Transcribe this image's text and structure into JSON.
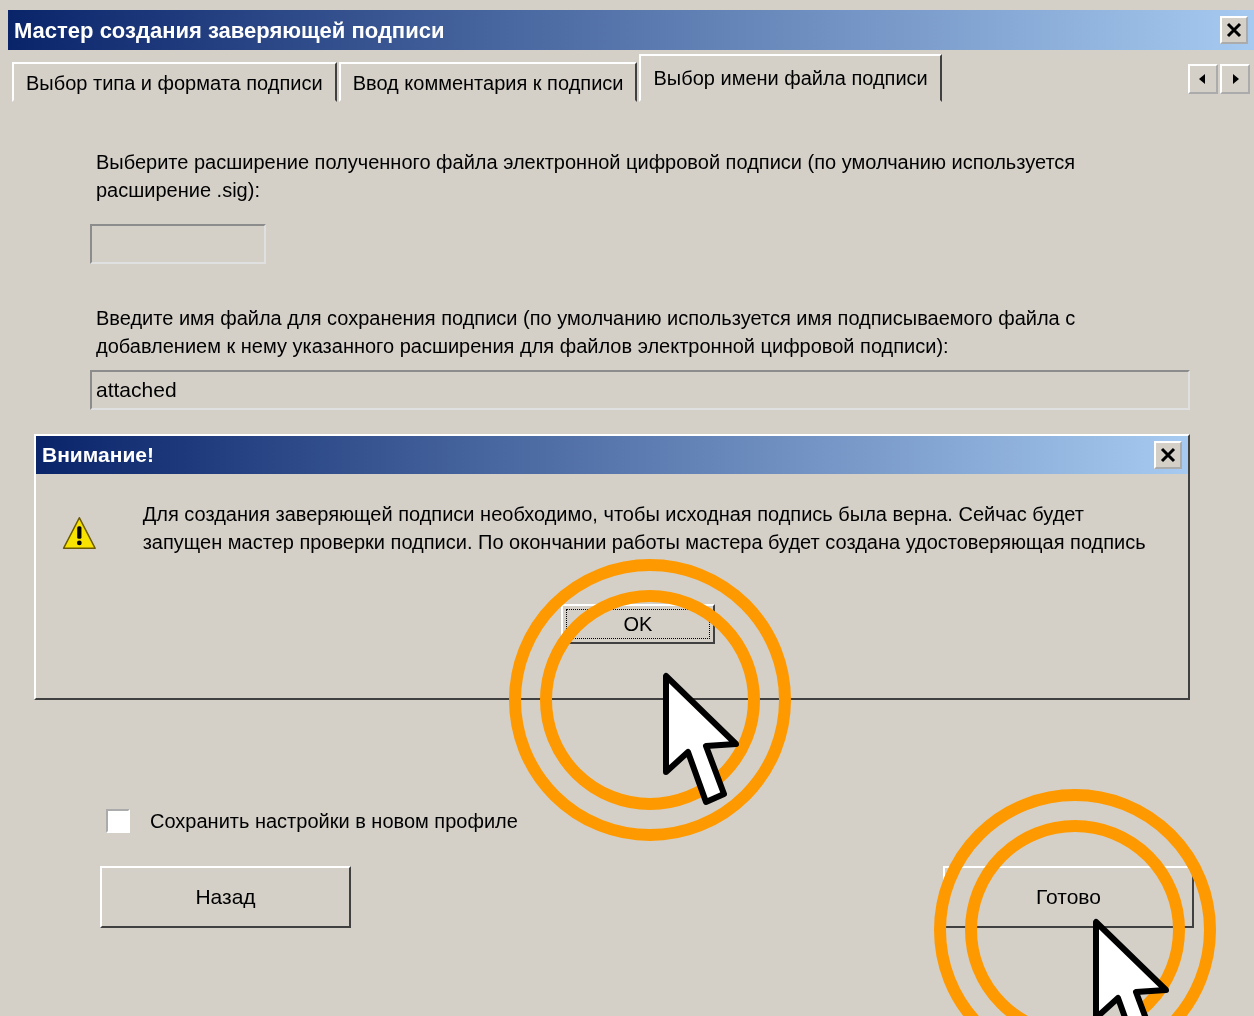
{
  "window": {
    "title": "Мастер создания заверяющей подписи"
  },
  "tabs": [
    {
      "label": "Выбор типа и формата подписи",
      "selected": false
    },
    {
      "label": "Ввод комментария к подписи",
      "selected": false
    },
    {
      "label": "Выбор имени файла подписи",
      "selected": true
    }
  ],
  "extension": {
    "label": "Выберите расширение полученного файла электронной цифровой подписи (по умолчанию используется расширение .sig):"
  },
  "filename": {
    "label": "Введите имя файла для сохранения подписи (по умолчанию используется имя подписываемого файла с добавлением к нему указанного расширения для файлов электронной цифровой подписи):",
    "value": "attached"
  },
  "alert": {
    "title": "Внимание!",
    "message": "Для создания заверяющей подписи необходимо, чтобы исходная подпись была верна. Сейчас будет запущен мастер проверки подписи. По окончании работы мастера будет создана удостоверяющая подпись",
    "button": "OK"
  },
  "save_profile": {
    "label": "Сохранить настройки в новом профиле",
    "checked": false
  },
  "buttons": [
    "Назад",
    "Готово"
  ]
}
